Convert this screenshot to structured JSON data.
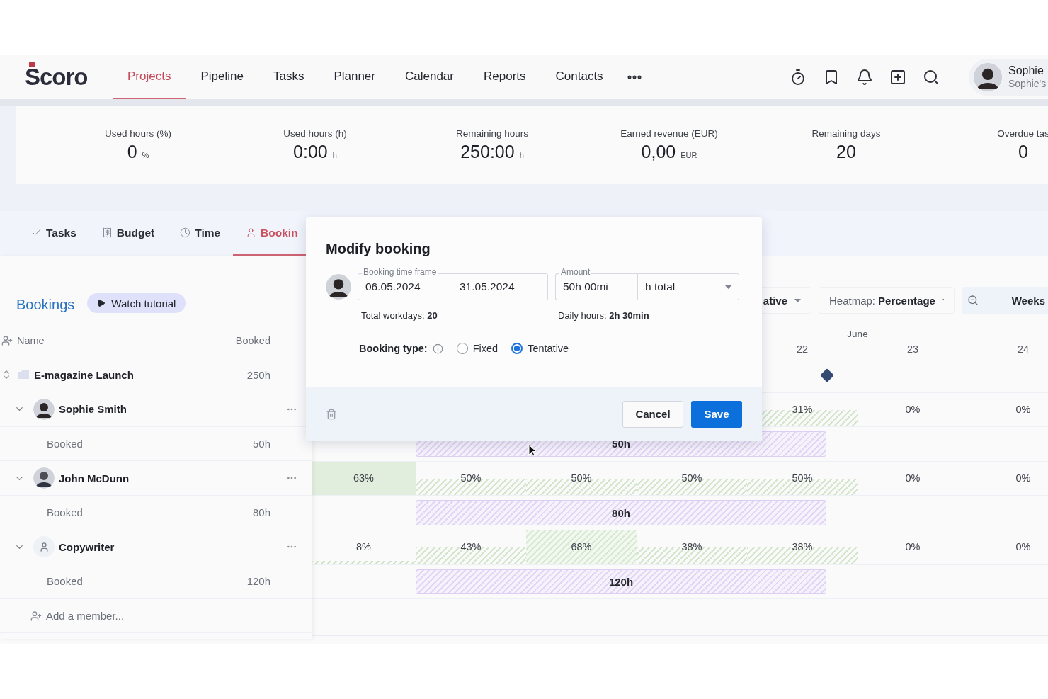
{
  "header": {
    "logo": "Scoro",
    "nav": [
      {
        "label": "Projects",
        "selected": true
      },
      {
        "label": "Pipeline",
        "selected": false
      },
      {
        "label": "Tasks",
        "selected": false
      },
      {
        "label": "Planner",
        "selected": false
      },
      {
        "label": "Calendar",
        "selected": false
      },
      {
        "label": "Reports",
        "selected": false
      },
      {
        "label": "Contacts",
        "selected": false
      }
    ],
    "user": {
      "name": "Sophie",
      "subtitle": "Sophie's"
    }
  },
  "stats": [
    {
      "label": "Used hours (%)",
      "value": "0",
      "unit": "%"
    },
    {
      "label": "Used hours (h)",
      "value": "0:00",
      "unit": "h"
    },
    {
      "label": "Remaining hours",
      "value": "250:00",
      "unit": "h"
    },
    {
      "label": "Earned revenue (EUR)",
      "value": "0,00",
      "unit": "EUR"
    },
    {
      "label": "Remaining days",
      "value": "20"
    },
    {
      "label": "Overdue tas",
      "value": "0"
    }
  ],
  "tabs": [
    {
      "label": "Tasks",
      "kind": "tasks",
      "selected": false
    },
    {
      "label": "Budget",
      "kind": "budget",
      "selected": false
    },
    {
      "label": "Time",
      "kind": "time",
      "selected": false
    },
    {
      "label": "Bookin",
      "kind": "bookings",
      "selected": true
    }
  ],
  "bookings": {
    "title": "Bookings",
    "tutorial_button": "Watch tutorial",
    "columns": [
      "Name",
      "Booked"
    ]
  },
  "toolbar": {
    "view_dropdown": "ative",
    "heatmap_label": "Heatmap:",
    "heatmap_value": "Percentage",
    "scale": "Weeks"
  },
  "timeline": {
    "month": "June",
    "days": [
      "22",
      "23",
      "24"
    ]
  },
  "rows": [
    {
      "kind": "project",
      "name": "E-magazine Launch",
      "booked": "250h",
      "milestone": true
    },
    {
      "kind": "person",
      "name": "Sophie Smith",
      "expanded": true,
      "cells": [
        {
          "text": "31%",
          "kind": "half"
        },
        {
          "text": "0%",
          "kind": "none"
        },
        {
          "text": "0%",
          "kind": "none"
        }
      ]
    },
    {
      "kind": "booking",
      "name": "Booked",
      "booked": "50h",
      "bar": "50h"
    },
    {
      "kind": "person",
      "name": "John McDunn",
      "expanded": true,
      "cells": [
        {
          "text": "63%",
          "kind": "solid"
        },
        {
          "text": "50%",
          "kind": "half"
        },
        {
          "text": "50%",
          "kind": "half"
        },
        {
          "text": "50%",
          "kind": "half"
        },
        {
          "text": "50%",
          "kind": "half"
        },
        {
          "text": "0%",
          "kind": "none"
        },
        {
          "text": "0%",
          "kind": "none"
        }
      ]
    },
    {
      "kind": "booking",
      "name": "Booked",
      "booked": "80h",
      "bar": "80h"
    },
    {
      "kind": "role",
      "name": "Copywriter",
      "expanded": true,
      "cells": [
        {
          "text": "8%",
          "kind": "thin"
        },
        {
          "text": "43%",
          "kind": "half"
        },
        {
          "text": "68%",
          "kind": "full"
        },
        {
          "text": "38%",
          "kind": "half"
        },
        {
          "text": "38%",
          "kind": "half"
        },
        {
          "text": "0%",
          "kind": "none"
        },
        {
          "text": "0%",
          "kind": "none"
        }
      ]
    },
    {
      "kind": "booking",
      "name": "Booked",
      "booked": "120h",
      "bar": "120h"
    }
  ],
  "add_member": "Add a member...",
  "modal": {
    "title": "Modify booking",
    "timeframe_label": "Booking time frame",
    "start": "06.05.2024",
    "end": "31.05.2024",
    "amount_label": "Amount",
    "amount": "50h 00mi",
    "unit": "h total",
    "workdays": "Total workdays: **20**",
    "daily": "Daily hours: **2h 30min**",
    "type_label": "Booking type:",
    "types": [
      {
        "label": "Fixed",
        "selected": false
      },
      {
        "label": "Tentative",
        "selected": true
      }
    ],
    "cancel": "Cancel",
    "save": "Save"
  }
}
